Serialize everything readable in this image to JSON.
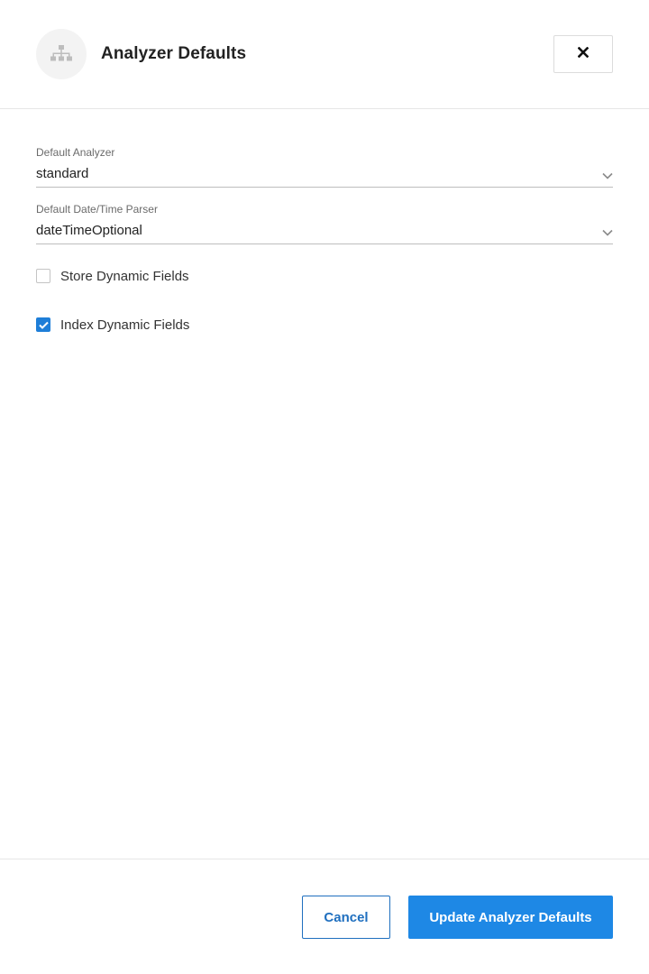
{
  "dialog": {
    "title": "Analyzer Defaults",
    "header_icon": "sitemap-icon",
    "close_icon": "close-icon"
  },
  "form": {
    "default_analyzer": {
      "label": "Default Analyzer",
      "value": "standard"
    },
    "default_date_parser": {
      "label": "Default Date/Time Parser",
      "value": "dateTimeOptional"
    },
    "store_dynamic_fields": {
      "label": "Store Dynamic Fields",
      "checked": false
    },
    "index_dynamic_fields": {
      "label": "Index Dynamic Fields",
      "checked": true
    }
  },
  "footer": {
    "cancel_label": "Cancel",
    "update_label": "Update Analyzer Defaults"
  },
  "colors": {
    "accent": "#1e88e5",
    "checkbox_checked": "#1e7ed8",
    "divider": "#e6e6e6"
  }
}
